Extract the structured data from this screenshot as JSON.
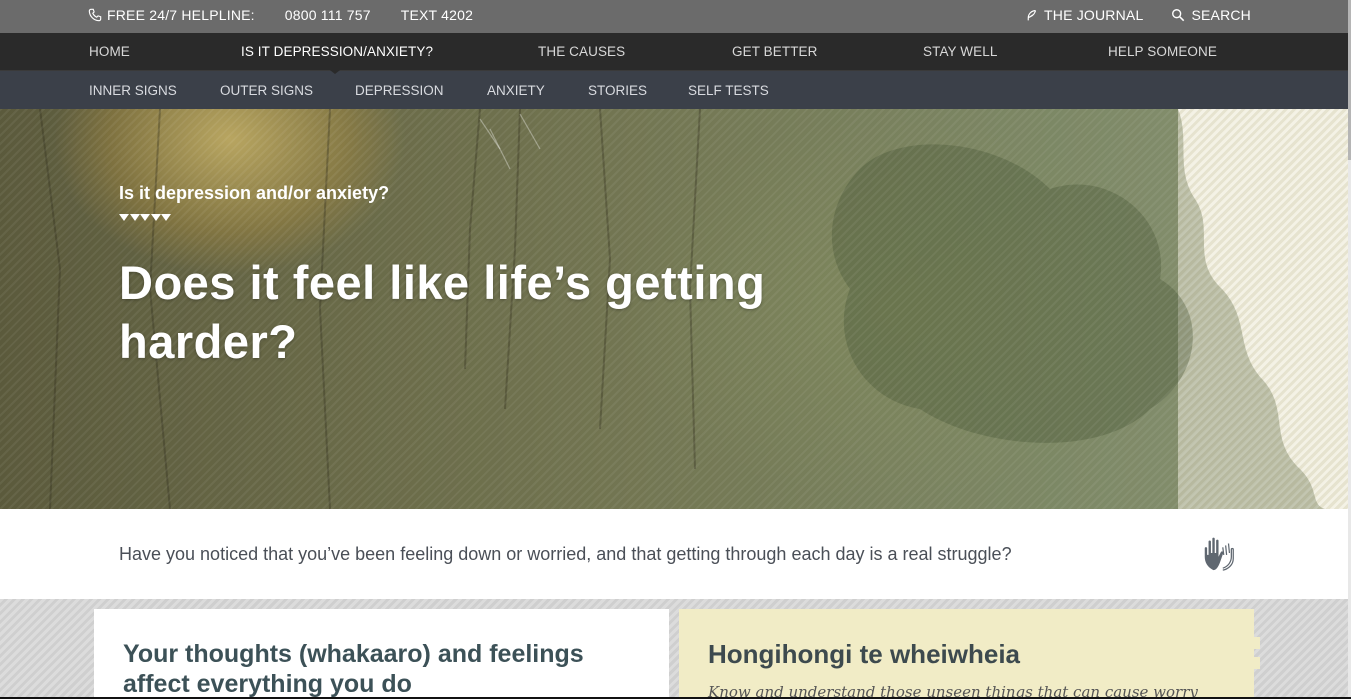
{
  "topbar": {
    "helpline_label": "FREE 24/7 HELPLINE:",
    "phone_number": "0800 111 757",
    "text_number": "TEXT 4202",
    "journal_label": "THE JOURNAL",
    "search_label": "SEARCH"
  },
  "main_nav": {
    "items": [
      {
        "label": "HOME"
      },
      {
        "label": "IS IT DEPRESSION/ANXIETY?"
      },
      {
        "label": "THE CAUSES"
      },
      {
        "label": "GET BETTER"
      },
      {
        "label": "STAY WELL"
      },
      {
        "label": "HELP SOMEONE"
      }
    ],
    "active": "IS IT DEPRESSION/ANXIETY?"
  },
  "sub_nav": {
    "items": [
      {
        "label": "INNER SIGNS"
      },
      {
        "label": "OUTER SIGNS"
      },
      {
        "label": "DEPRESSION"
      },
      {
        "label": "ANXIETY"
      },
      {
        "label": "STORIES"
      },
      {
        "label": "SELF TESTS"
      }
    ]
  },
  "hero": {
    "kicker": "Is it depression and/or anxiety?",
    "headline": "Does it feel like life’s getting harder?"
  },
  "intro": {
    "text": "Have you noticed that you’ve been feeling down or worried, and that getting through each day is a real struggle?",
    "icon": "hand-sign-icon"
  },
  "cards": {
    "left_title": "Your thoughts (whakaaro) and feelings affect everything you do",
    "right_title": "Hongihongi te wheiwheia",
    "right_text": "Know and understand those unseen things that can cause worry"
  },
  "colors": {
    "topbar": "#6b6b6b",
    "main_nav": "#2a2a2a",
    "sub_nav": "#3b4049",
    "card_yellow": "#f1ecc6",
    "heading_teal": "#3c5157"
  }
}
